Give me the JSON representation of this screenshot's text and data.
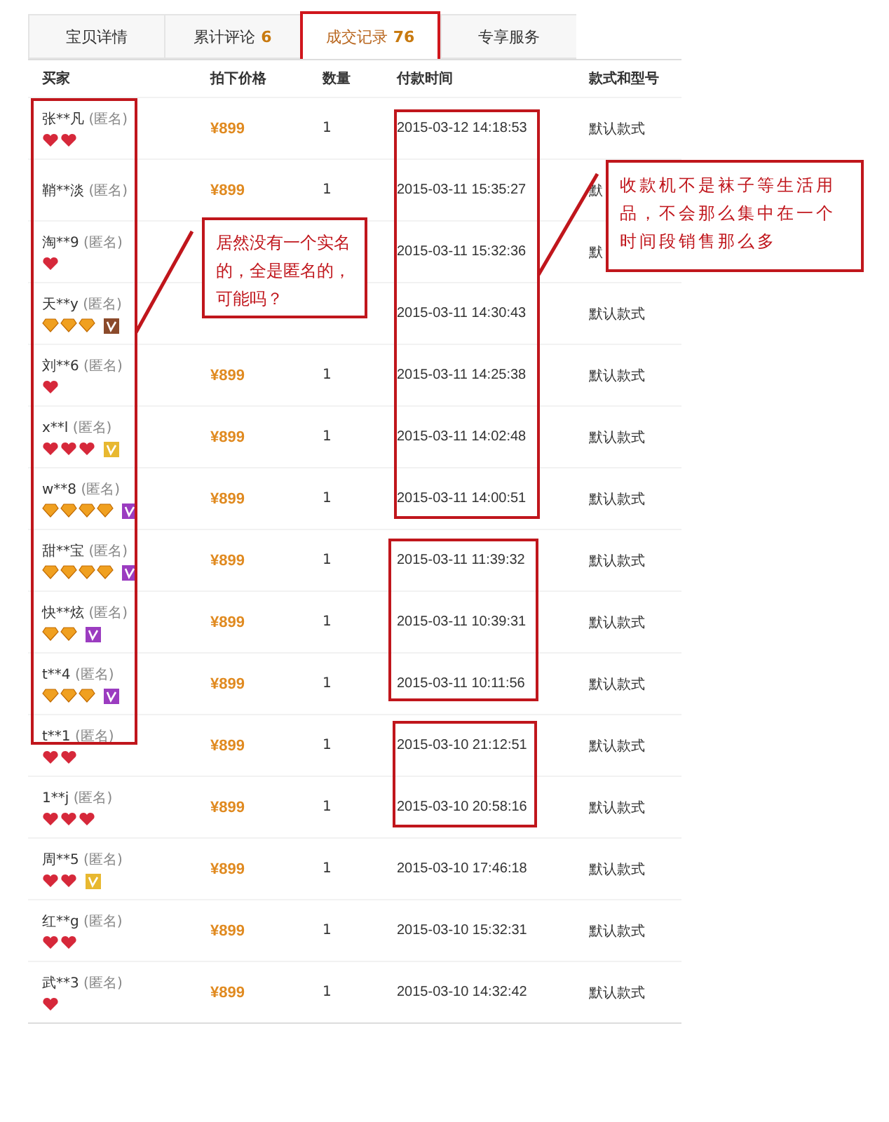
{
  "tabs": [
    {
      "label": "宝贝详情",
      "selected": false
    },
    {
      "label": "累计评论",
      "count": "6",
      "selected": false
    },
    {
      "label": "成交记录",
      "count": "76",
      "selected": true
    },
    {
      "label": "专享服务",
      "selected": false
    }
  ],
  "table": {
    "columns": [
      "买家",
      "拍下价格",
      "数量",
      "付款时间",
      "款式和型号"
    ],
    "rows": [
      {
        "buyer": "张**凡",
        "anon": "(匿名)",
        "rank": [
          {
            "kind": "heart"
          },
          {
            "kind": "heart"
          }
        ],
        "price": "¥899",
        "qty": "1",
        "time": "2015-03-12 14:18:53",
        "model": "默认款式"
      },
      {
        "buyer": "鞘**淡",
        "anon": "(匿名)",
        "price": "¥899",
        "qty": "1",
        "time": "2015-03-11 15:35:27",
        "model": "默"
      },
      {
        "buyer": "淘**9",
        "anon": "(匿名)",
        "rank": [
          {
            "kind": "heart"
          }
        ],
        "time": "2015-03-11 15:32:36",
        "model": "默"
      },
      {
        "buyer": "天**y",
        "anon": "(匿名)",
        "rank": [
          {
            "kind": "diamond"
          },
          {
            "kind": "diamond"
          },
          {
            "kind": "diamond"
          }
        ],
        "badge": {
          "color": "#8b4a2b"
        },
        "time": "2015-03-11 14:30:43",
        "model": "默认款式"
      },
      {
        "buyer": "刘**6",
        "anon": "(匿名)",
        "rank": [
          {
            "kind": "heart"
          }
        ],
        "price": "¥899",
        "qty": "1",
        "time": "2015-03-11 14:25:38",
        "model": "默认款式"
      },
      {
        "buyer": "x**l",
        "anon": "(匿名)",
        "rank": [
          {
            "kind": "heart"
          },
          {
            "kind": "heart"
          },
          {
            "kind": "heart"
          }
        ],
        "badge": {
          "color": "#e8b830"
        },
        "price": "¥899",
        "qty": "1",
        "time": "2015-03-11 14:02:48",
        "model": "默认款式"
      },
      {
        "buyer": "w**8",
        "anon": "(匿名)",
        "rank": [
          {
            "kind": "diamond"
          },
          {
            "kind": "diamond"
          },
          {
            "kind": "diamond"
          },
          {
            "kind": "diamond"
          }
        ],
        "badge": {
          "color": "#9b3cc0"
        },
        "price": "¥899",
        "qty": "1",
        "time": "2015-03-11 14:00:51",
        "model": "默认款式"
      },
      {
        "buyer": "甜**宝",
        "anon": "(匿名)",
        "rank": [
          {
            "kind": "diamond"
          },
          {
            "kind": "diamond"
          },
          {
            "kind": "diamond"
          },
          {
            "kind": "diamond"
          }
        ],
        "badge": {
          "color": "#9b3cc0"
        },
        "price": "¥899",
        "qty": "1",
        "time": "2015-03-11 11:39:32",
        "model": "默认款式"
      },
      {
        "buyer": "快**炫",
        "anon": "(匿名)",
        "rank": [
          {
            "kind": "diamond"
          },
          {
            "kind": "diamond"
          }
        ],
        "badge": {
          "color": "#9b3cc0"
        },
        "price": "¥899",
        "qty": "1",
        "time": "2015-03-11 10:39:31",
        "model": "默认款式"
      },
      {
        "buyer": "t**4",
        "anon": "(匿名)",
        "rank": [
          {
            "kind": "diamond"
          },
          {
            "kind": "diamond"
          },
          {
            "kind": "diamond"
          }
        ],
        "badge": {
          "color": "#9b3cc0"
        },
        "price": "¥899",
        "qty": "1",
        "time": "2015-03-11 10:11:56",
        "model": "默认款式"
      },
      {
        "buyer": "t**1",
        "anon": "(匿名)",
        "rank": [
          {
            "kind": "heart"
          },
          {
            "kind": "heart"
          }
        ],
        "price": "¥899",
        "qty": "1",
        "time": "2015-03-10 21:12:51",
        "model": "默认款式"
      },
      {
        "buyer": "1**j",
        "anon": "(匿名)",
        "rank": [
          {
            "kind": "heart"
          },
          {
            "kind": "heart"
          },
          {
            "kind": "heart"
          }
        ],
        "price": "¥899",
        "qty": "1",
        "time": "2015-03-10 20:58:16",
        "model": "默认款式"
      },
      {
        "buyer": "周**5",
        "anon": "(匿名)",
        "rank": [
          {
            "kind": "heart"
          },
          {
            "kind": "heart"
          }
        ],
        "badge": {
          "color": "#e8b830"
        },
        "price": "¥899",
        "qty": "1",
        "time": "2015-03-10 17:46:18",
        "model": "默认款式"
      },
      {
        "buyer": "红**g",
        "anon": "(匿名)",
        "rank": [
          {
            "kind": "heart"
          },
          {
            "kind": "heart"
          }
        ],
        "price": "¥899",
        "qty": "1",
        "time": "2015-03-10 15:32:31",
        "model": "默认款式"
      },
      {
        "buyer": "武**3",
        "anon": "(匿名)",
        "rank": [
          {
            "kind": "heart"
          }
        ],
        "price": "¥899",
        "qty": "1",
        "time": "2015-03-10 14:32:42",
        "model": "默认款式"
      }
    ]
  },
  "annotations": [
    {
      "text": "居然没有一个实名的，全是匿名的，可能吗？"
    },
    {
      "text": "收款机不是袜子等生活用品，不会那么集中在一个时间段销售那么多"
    }
  ]
}
